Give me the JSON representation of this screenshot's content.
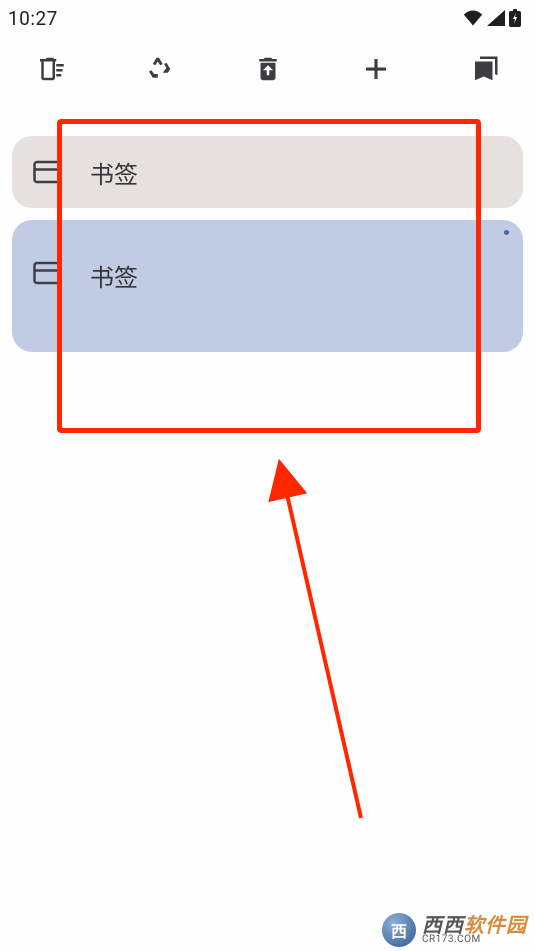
{
  "status": {
    "time": "10:27"
  },
  "toolbar": {
    "icons": {
      "delete": "delete-sweep-icon",
      "recycle": "recycle-icon",
      "restore": "restore-trash-icon",
      "add": "plus-icon",
      "bookmarks": "bookmarks-stack-icon"
    }
  },
  "list": {
    "item1": {
      "label": "书签"
    },
    "item2": {
      "label": "书签"
    }
  },
  "watermark": {
    "badge": "西",
    "main_a": "西西",
    "main_b": "软件园",
    "sub": "CR173.COM"
  }
}
